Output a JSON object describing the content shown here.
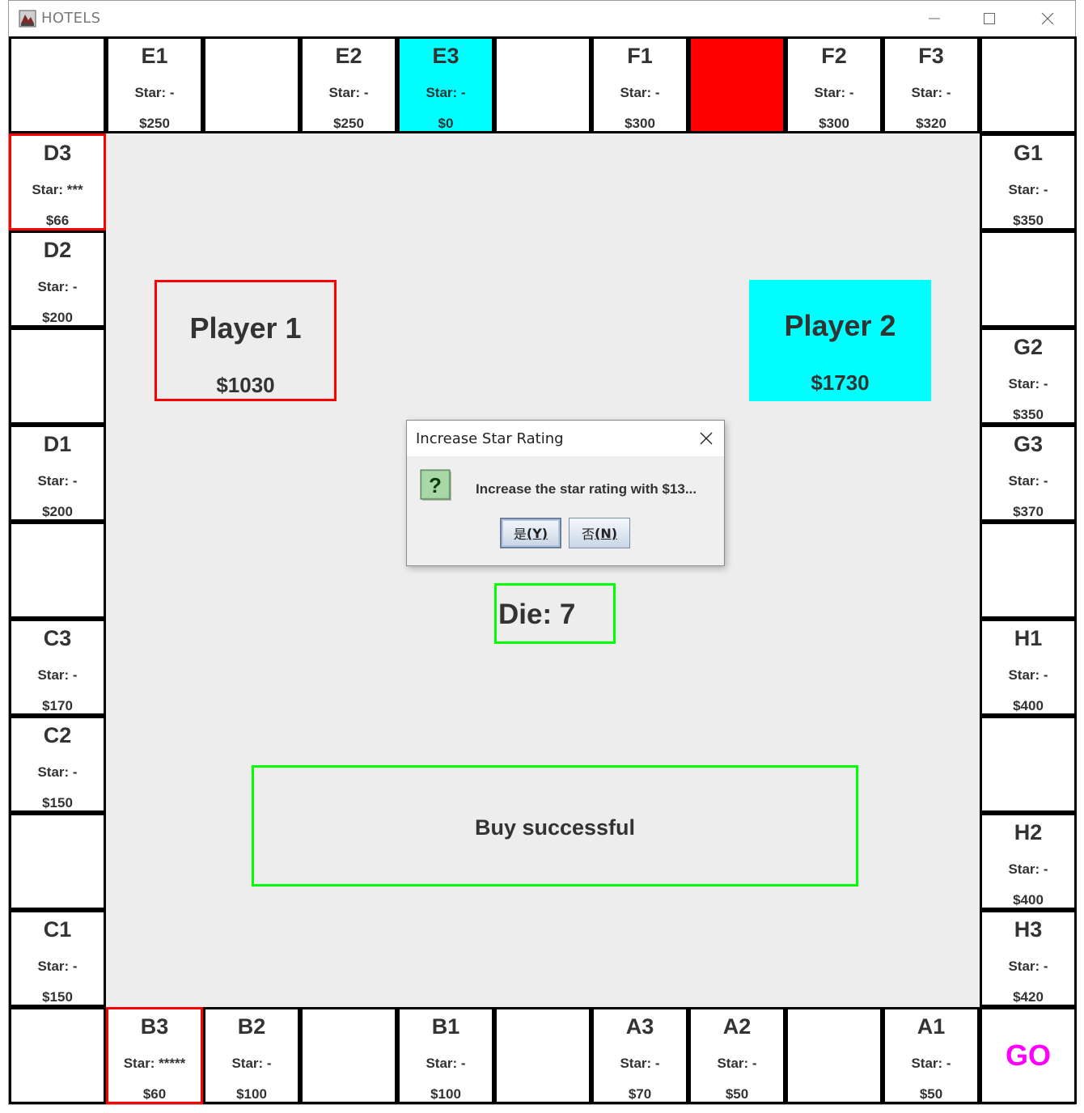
{
  "window": {
    "title": "HOTELS"
  },
  "board": {
    "top": [
      {
        "name": "",
        "star": "",
        "price": "",
        "fill": "white"
      },
      {
        "name": "E1",
        "star": "Star: -",
        "price": "$250",
        "fill": "white"
      },
      {
        "name": "",
        "star": "",
        "price": "",
        "fill": "white"
      },
      {
        "name": "E2",
        "star": "Star: -",
        "price": "$250",
        "fill": "white"
      },
      {
        "name": "E3",
        "star": "Star: -",
        "price": "$0",
        "fill": "cyan"
      },
      {
        "name": "",
        "star": "",
        "price": "",
        "fill": "white"
      },
      {
        "name": "F1",
        "star": "Star: -",
        "price": "$300",
        "fill": "white"
      },
      {
        "name": "",
        "star": "",
        "price": "",
        "fill": "red"
      },
      {
        "name": "F2",
        "star": "Star: -",
        "price": "$300",
        "fill": "white"
      },
      {
        "name": "F3",
        "star": "Star: -",
        "price": "$320",
        "fill": "white"
      },
      {
        "name": "",
        "star": "",
        "price": "",
        "fill": "white"
      }
    ],
    "left": [
      {
        "name": "D3",
        "star": "Star: ***",
        "price": "$66",
        "fill": "white",
        "outline": "red"
      },
      {
        "name": "D2",
        "star": "Star: -",
        "price": "$200",
        "fill": "white"
      },
      {
        "name": "",
        "star": "",
        "price": "",
        "fill": "white"
      },
      {
        "name": "D1",
        "star": "Star: -",
        "price": "$200",
        "fill": "white"
      },
      {
        "name": "",
        "star": "",
        "price": "",
        "fill": "white"
      },
      {
        "name": "C3",
        "star": "Star: -",
        "price": "$170",
        "fill": "white"
      },
      {
        "name": "C2",
        "star": "Star: -",
        "price": "$150",
        "fill": "white"
      },
      {
        "name": "",
        "star": "",
        "price": "",
        "fill": "white"
      },
      {
        "name": "C1",
        "star": "Star: -",
        "price": "$150",
        "fill": "white"
      }
    ],
    "right": [
      {
        "name": "G1",
        "star": "Star: -",
        "price": "$350",
        "fill": "white"
      },
      {
        "name": "",
        "star": "",
        "price": "",
        "fill": "white"
      },
      {
        "name": "G2",
        "star": "Star: -",
        "price": "$350",
        "fill": "white"
      },
      {
        "name": "G3",
        "star": "Star: -",
        "price": "$370",
        "fill": "white"
      },
      {
        "name": "",
        "star": "",
        "price": "",
        "fill": "white"
      },
      {
        "name": "H1",
        "star": "Star: -",
        "price": "$400",
        "fill": "white"
      },
      {
        "name": "",
        "star": "",
        "price": "",
        "fill": "white"
      },
      {
        "name": "H2",
        "star": "Star: -",
        "price": "$400",
        "fill": "white"
      },
      {
        "name": "H3",
        "star": "Star: -",
        "price": "$420",
        "fill": "white"
      }
    ],
    "bottom": [
      {
        "name": "",
        "star": "",
        "price": "",
        "fill": "white"
      },
      {
        "name": "B3",
        "star": "Star: *****",
        "price": "$60",
        "fill": "white",
        "outline": "red"
      },
      {
        "name": "B2",
        "star": "Star: -",
        "price": "$100",
        "fill": "white"
      },
      {
        "name": "",
        "star": "",
        "price": "",
        "fill": "white"
      },
      {
        "name": "B1",
        "star": "Star: -",
        "price": "$100",
        "fill": "white"
      },
      {
        "name": "",
        "star": "",
        "price": "",
        "fill": "white"
      },
      {
        "name": "A3",
        "star": "Star: -",
        "price": "$70",
        "fill": "white"
      },
      {
        "name": "A2",
        "star": "Star: -",
        "price": "$50",
        "fill": "white"
      },
      {
        "name": "",
        "star": "",
        "price": "",
        "fill": "white"
      },
      {
        "name": "A1",
        "star": "Star: -",
        "price": "$50",
        "fill": "white"
      },
      {
        "name": "GO",
        "star": "",
        "price": "",
        "fill": "white",
        "go": true
      }
    ]
  },
  "players": [
    {
      "label": "Player 1",
      "money": "$1030"
    },
    {
      "label": "Player 2",
      "money": "$1730"
    }
  ],
  "die": {
    "label": "Die: 7"
  },
  "message": {
    "text": "Buy successful"
  },
  "dialog": {
    "title": "Increase Star Rating",
    "message": "Increase the star rating with $13...",
    "yes_label": "是",
    "yes_key": "(Y)",
    "no_label": "否",
    "no_key": "(N)"
  },
  "colors": {
    "cyan": "#00ffff",
    "red": "#ff0000",
    "green_outline": "#00ff00",
    "go_magenta": "#ff00ff",
    "board_bg": "#ededed"
  }
}
